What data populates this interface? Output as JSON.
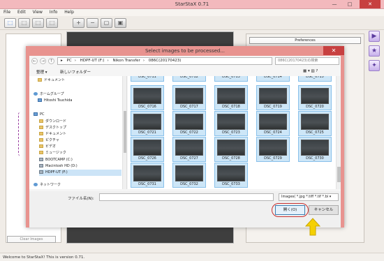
{
  "app": {
    "title": "StarStaX 0.71",
    "menu": [
      "File",
      "Edit",
      "View",
      "Info",
      "Help"
    ],
    "preferences_label": "Preferences",
    "clear_images_label": "Clear Images",
    "status": "Welcome to StarStaX! This is version 0.71.",
    "win_min": "—",
    "win_max": "□",
    "win_close": "✕"
  },
  "dialog": {
    "title": "Select images to be processed...",
    "close": "✕",
    "nav_back": "←",
    "nav_forward": "→",
    "nav_up": "↑",
    "address": [
      "PC",
      "HDPF-UT (F:)",
      "Nikon Transfer",
      "086C(20170423)"
    ],
    "search_placeholder": "086C(20170423)の検索",
    "organize": "整理 ▾",
    "new_folder": "新しいフォルダー",
    "view_icons": "▦ ▾  ▥  ?",
    "tree": [
      {
        "label": "ドキュメント",
        "icon": "folder"
      },
      {
        "label": "ホームグループ",
        "icon": "net"
      },
      {
        "label": "Hitoshi Tsuchida",
        "icon": "pc"
      },
      {
        "label": "PC",
        "icon": "pc"
      },
      {
        "label": "ダウンロード",
        "icon": "folder"
      },
      {
        "label": "デスクトップ",
        "icon": "folder"
      },
      {
        "label": "ドキュメント",
        "icon": "folder"
      },
      {
        "label": "ピクチャ",
        "icon": "folder"
      },
      {
        "label": "ビデオ",
        "icon": "folder"
      },
      {
        "label": "ミュージック",
        "icon": "folder"
      },
      {
        "label": "BOOTCAMP (C:)",
        "icon": "drive"
      },
      {
        "label": "Macintosh HD (D:)",
        "icon": "drive"
      },
      {
        "label": "HDPF-UT (F:)",
        "icon": "drive"
      },
      {
        "label": "ネットワーク",
        "icon": "net"
      }
    ],
    "files_top_row": [
      "DSC_0711",
      "DSC_0712",
      "DSC_0713",
      "DSC_0714",
      "DSC_0715"
    ],
    "files": [
      "DSC_0716",
      "DSC_0717",
      "DSC_0718",
      "DSC_0719",
      "DSC_0720",
      "DSC_0721",
      "DSC_0722",
      "DSC_0723",
      "DSC_0724",
      "DSC_0725",
      "DSC_0726",
      "DSC_0727",
      "DSC_0728",
      "DSC_0729",
      "DSC_0730",
      "DSC_0731",
      "DSC_0732",
      "DSC_0733"
    ],
    "filename_label": "ファイル名(N):",
    "filename_value": "",
    "filetype": "Images( *.jpg *.tiff *.tif *.bi ▾",
    "open_label": "開く(O)",
    "cancel_label": "キャンセル"
  },
  "colors": {
    "title_pink": "#f3b9bd",
    "dialog_frame": "#e8938f",
    "selection_blue": "#cde6f7",
    "hint_arrow": "#f5d000"
  }
}
